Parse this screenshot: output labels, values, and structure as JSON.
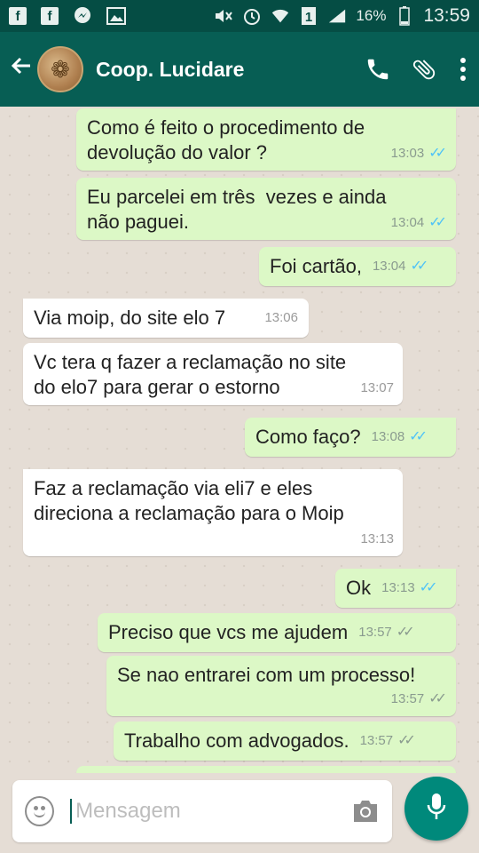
{
  "status_bar": {
    "battery": "16%",
    "time": "13:59",
    "sim_label": "1"
  },
  "header": {
    "title": "Coop. Lucidare",
    "back_icon": "arrow-left-icon",
    "call_icon": "phone-icon",
    "attach_icon": "paperclip-icon",
    "menu_icon": "more-vert-icon"
  },
  "messages": [
    {
      "dir": "out",
      "text": "Como é feito o procedimento de\ndevolução do valor ?",
      "time": "13:03",
      "status": "read"
    },
    {
      "dir": "out",
      "text": "Eu parcelei em três  vezes e ainda\nnão paguei.",
      "time": "13:04",
      "status": "read"
    },
    {
      "dir": "out",
      "text": "Foi cartão,",
      "time": "13:04",
      "status": "read"
    },
    {
      "dir": "in",
      "text": "Via moip, do site elo 7",
      "time": "13:06"
    },
    {
      "dir": "in",
      "text": "Vc tera q fazer a reclamação no site\ndo elo7 para gerar o estorno",
      "time": "13:07"
    },
    {
      "dir": "out",
      "text": "Como faço?",
      "time": "13:08",
      "status": "read"
    },
    {
      "dir": "in",
      "text": "Faz a reclamação via eli7 e eles\ndireciona a reclamação para o Moip",
      "time": "13:13"
    },
    {
      "dir": "out",
      "text": "Ok",
      "time": "13:13",
      "status": "read"
    },
    {
      "dir": "out",
      "text": "Preciso que vcs me ajudem",
      "time": "13:57",
      "status": "delivered"
    },
    {
      "dir": "out",
      "text": "Se nao entrarei com um processo!",
      "time": "13:57",
      "status": "delivered"
    },
    {
      "dir": "out",
      "text": "Trabalho com advogados.",
      "time": "13:57",
      "status": "delivered"
    }
  ],
  "composer": {
    "placeholder": "Mensagem",
    "emoji_icon": "emoji-icon",
    "camera_icon": "camera-icon",
    "mic_icon": "microphone-icon"
  },
  "colors": {
    "header": "#075e54",
    "status_bar": "#054d44",
    "outgoing_bubble": "#dcf8c6",
    "incoming_bubble": "#ffffff",
    "read_ticks": "#4fc3f7",
    "mic_button": "#00897b"
  }
}
